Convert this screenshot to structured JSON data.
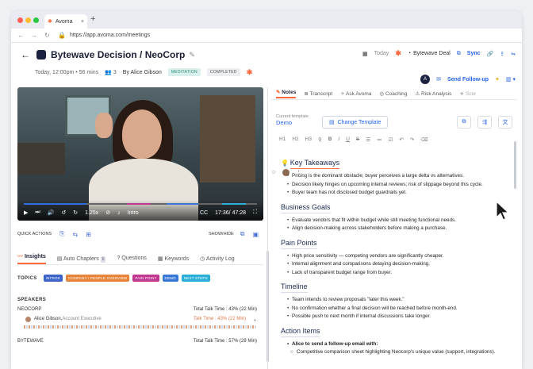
{
  "browser": {
    "tab_title": "Avoma",
    "tab_close": "×",
    "new_tab": "+",
    "url": "https://app.avoma.com/meetings"
  },
  "header": {
    "title": "Bytewave Decision / NeoCorp",
    "today": "Today",
    "deal": "Bytewave Deal",
    "sync": "Sync"
  },
  "meta": {
    "date": "Today, 12:00pm • 56 mins",
    "attendees": "3",
    "by": "By Alice Gibson",
    "meditation_badge": "MEDITATION",
    "completed_badge": "COMPLETED"
  },
  "actions": {
    "avatar_initial": "A",
    "send_followup": "Send Follow-up"
  },
  "video": {
    "speed": "1.25x",
    "chapter": "Intro",
    "time": "17:36/ 47:28",
    "cc": "CC",
    "played_fraction": 0.27
  },
  "quick_actions": {
    "label": "QUICK ACTIONS",
    "show_hide": "SHOW/HIDE"
  },
  "left_tabs": [
    {
      "label": "Insights"
    },
    {
      "label": "Auto Chapters",
      "count": "6"
    },
    {
      "label": "Questions"
    },
    {
      "label": "Keywords"
    },
    {
      "label": "Activity Log"
    }
  ],
  "topics": {
    "label": "TOPICS",
    "items": [
      {
        "label": "INTROS",
        "color": "#3b63c9"
      },
      {
        "label": "COMPANY / PEOPLE OVERVIEW",
        "color": "#e8843a"
      },
      {
        "label": "PAIN POINT",
        "color": "#c2378f"
      },
      {
        "label": "DEMO",
        "color": "#3a78d8"
      },
      {
        "label": "NEXT STEPS",
        "color": "#2ab0d8"
      }
    ]
  },
  "speakers": {
    "label": "SPEAKERS",
    "groups": [
      {
        "company": "NEOCORP",
        "total": "Total Talk Time : 43% (22 Min)"
      },
      {
        "company": "BYTEWAVE",
        "total": "Total Talk Time : 57% (28 Min)"
      }
    ],
    "person": {
      "name": "Alice Gibson,",
      "role": " Account Executive",
      "talk": "Talk Time : 43% (22 Min)"
    }
  },
  "right_tabs": [
    "Notes",
    "Transcript",
    "Ask Avoma",
    "Coaching",
    "Risk Analysis",
    "Scor"
  ],
  "template": {
    "label": "Current template",
    "value": "Demo",
    "change": "Change Template"
  },
  "format_bar": [
    "H1",
    "H2",
    "H3",
    "B",
    "I",
    "U",
    "S"
  ],
  "notes": {
    "key_takeaways": {
      "heading": "Key Takeaways",
      "items": [
        "Pricing is the dominant obstacle; buyer perceives a large delta vs alternatives.",
        "Decision likely hinges on upcoming internal reviews; risk of slippage beyond this cycle.",
        "Buyer team has not disclosed budget guardrails yet."
      ]
    },
    "business_goals": {
      "heading": "Business Goals",
      "items": [
        "Evaluate vendors that fit within budget while still meeting functional needs.",
        "Align decision-making across stakeholders before making a purchase."
      ]
    },
    "pain_points": {
      "heading": "Pain Points",
      "items": [
        "High price sensitivity — competing vendors are significantly cheaper.",
        "Internal alignment and comparisons delaying decision-making.",
        "Lack of transparent budget range from buyer."
      ]
    },
    "timeline": {
      "heading": "Timeline",
      "items": [
        "Team intends to review proposals \"later this week.\"",
        "No confirmation whether a final decision will be reached before month-end.",
        "Possible push to next month if internal discussions take longer."
      ]
    },
    "action_items": {
      "heading": "Action Items",
      "bold_item": "Alice to send a follow-up email with:",
      "sub_item": "Competitive comparison sheet highlighting Neocorp's unique value (support, integrations)."
    }
  }
}
